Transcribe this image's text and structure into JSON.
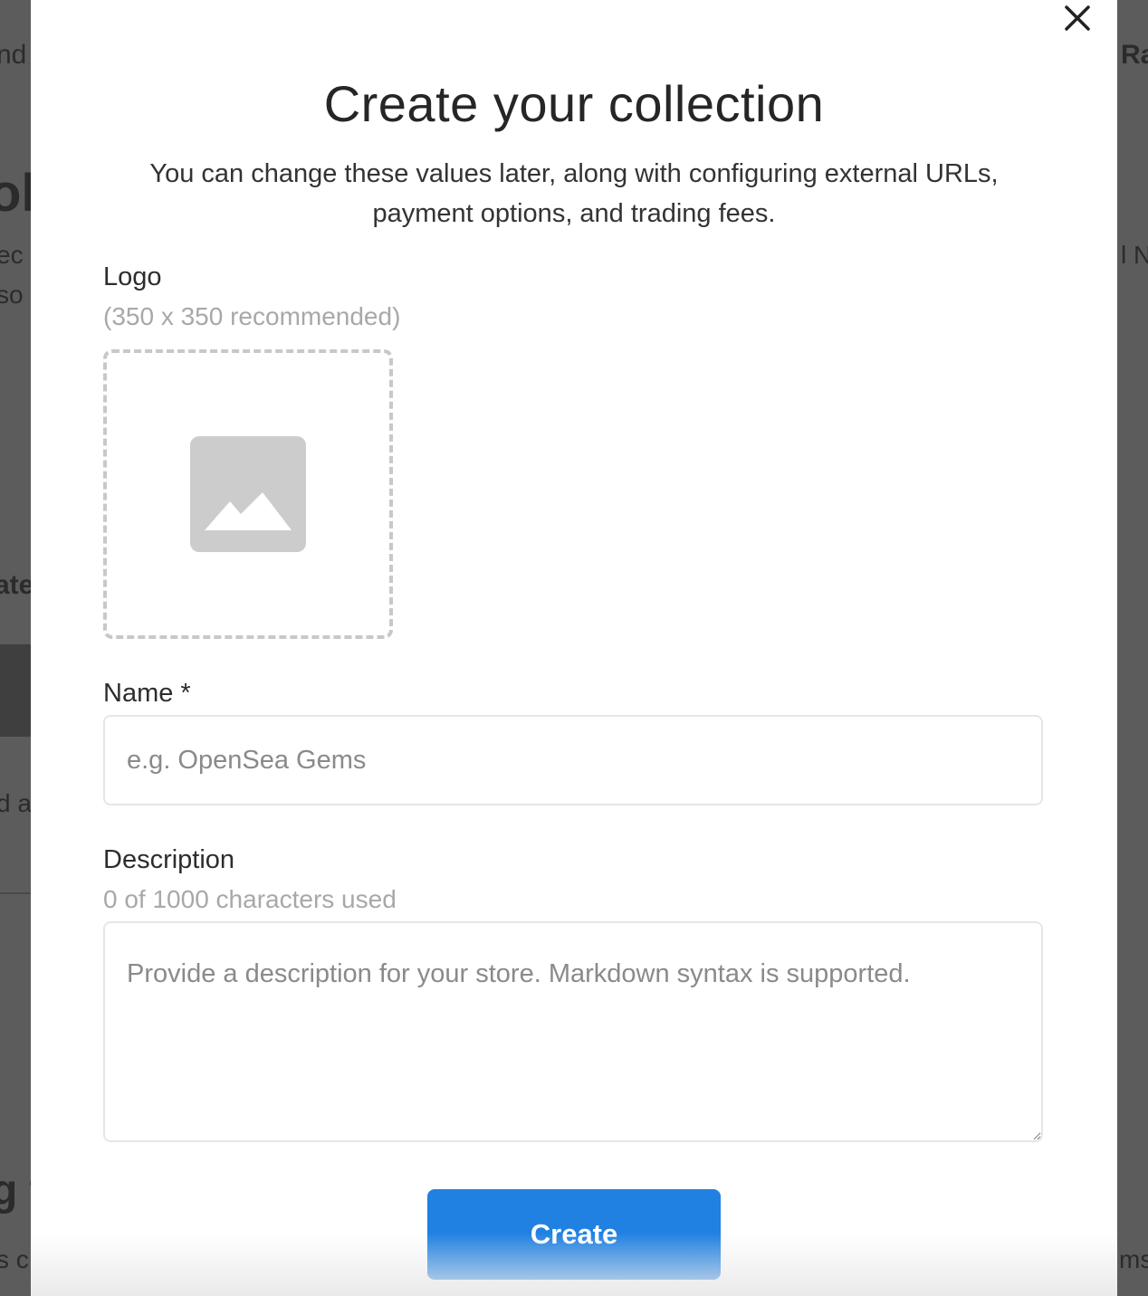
{
  "background": {
    "fragments": [
      "nd",
      "oll",
      "ec",
      "so",
      "ate",
      "d a",
      "g t",
      "s c",
      "Ra",
      "l N",
      "ms"
    ]
  },
  "modal": {
    "close_icon": "close-icon",
    "title": "Create your collection",
    "subtitle": "You can change these values later, along with configuring external URLs, payment options, and trading fees.",
    "logo": {
      "label": "Logo",
      "hint": "(350 x 350 recommended)",
      "icon": "image-placeholder-icon"
    },
    "name": {
      "label": "Name *",
      "placeholder": "e.g. OpenSea Gems",
      "value": ""
    },
    "description": {
      "label": "Description",
      "counter": "0 of 1000 characters used",
      "placeholder": "Provide a description for your store. Markdown syntax is supported.",
      "value": ""
    },
    "create_label": "Create"
  },
  "colors": {
    "accent": "#2081e2",
    "overlay": "#5c5c5c"
  }
}
